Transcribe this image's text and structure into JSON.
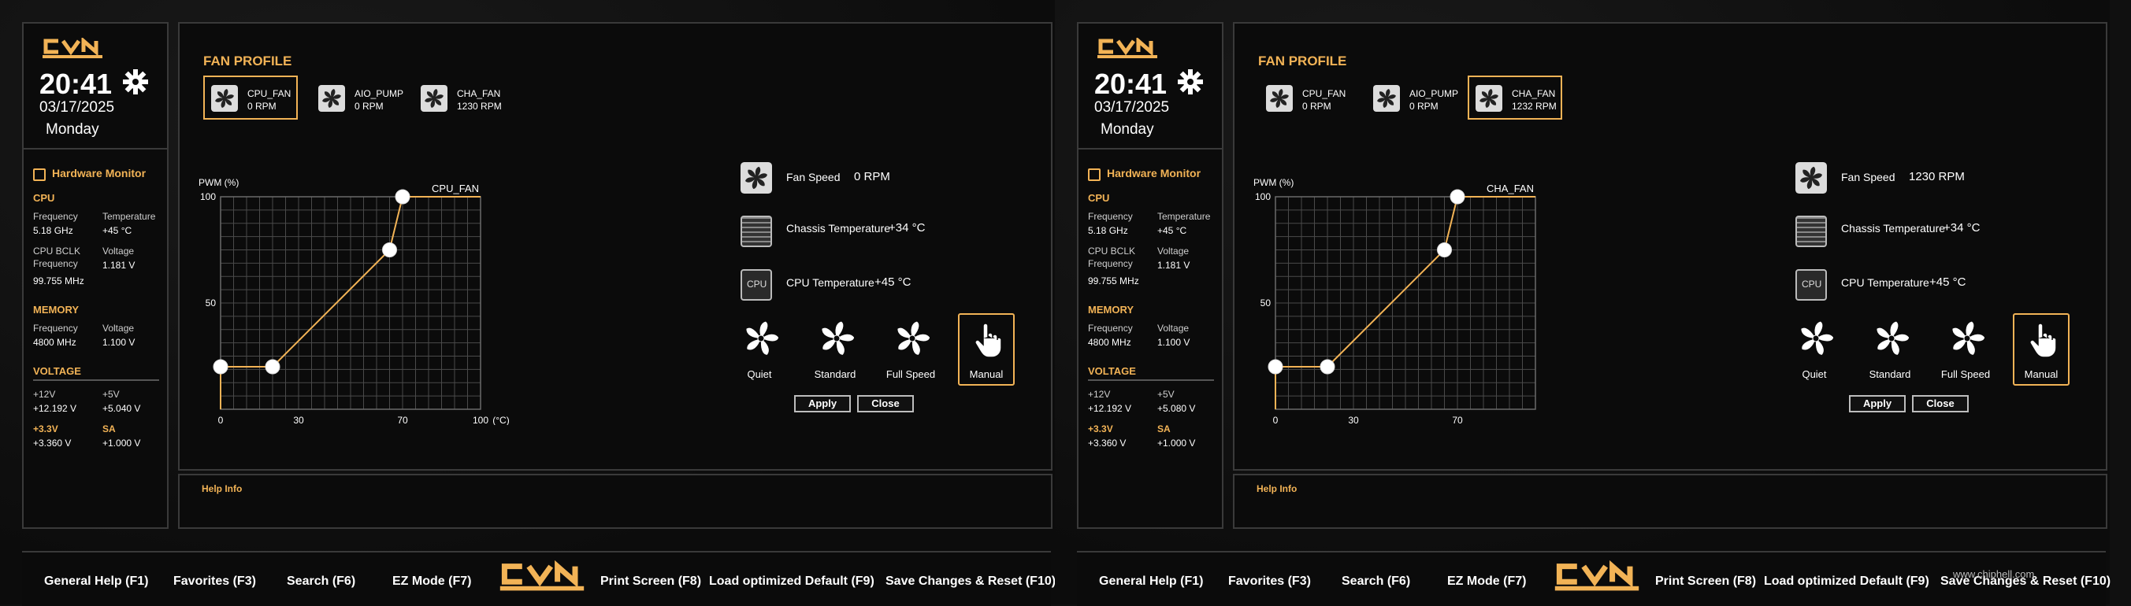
{
  "colors": {
    "accent": "#f2b356",
    "background": "#0b0b0b",
    "border": "#3a3a3a"
  },
  "screens": [
    {
      "logo": "CVN",
      "time": "20:41",
      "date": "03/17/2025",
      "day": "Monday",
      "section_title": "FAN PROFILE",
      "fans": [
        {
          "name": "CPU_FAN",
          "rpm": "0 RPM",
          "active": true
        },
        {
          "name": "AIO_PUMP",
          "rpm": "0 RPM",
          "active": false
        },
        {
          "name": "CHA_FAN",
          "rpm": "1230 RPM",
          "active": false
        }
      ],
      "chart_data": {
        "type": "line",
        "title": "CPU_FAN",
        "ylabel": "PWM",
        "ylabel_unit": "(%)",
        "xlabel_unit": "(°C)",
        "x": [
          0,
          0,
          20,
          65,
          70,
          100
        ],
        "y": [
          0,
          20,
          20,
          75,
          100,
          100
        ],
        "control_points_x": [
          0,
          20,
          65,
          70
        ],
        "control_points_y": [
          20,
          20,
          75,
          100
        ],
        "xlim": [
          0,
          100
        ],
        "ylim": [
          0,
          100
        ],
        "xticks": [
          "0",
          "30",
          "70",
          "100"
        ],
        "xtick_values": [
          0,
          30,
          70,
          100
        ],
        "yticks": [
          "100",
          "50"
        ],
        "ytick_values": [
          100,
          50
        ],
        "grid": true
      },
      "fan_speed_label": "Fan Speed",
      "fan_speed_value": "0 RPM",
      "chassis_temp_label": "Chassis Temperature",
      "chassis_temp_value": "+34 °C",
      "cpu_temp_label": "CPU Temperature",
      "cpu_temp_value": "+45 °C",
      "cpu_icon_text": "CPU",
      "modes": [
        "Quiet",
        "Standard",
        "Full Speed",
        "Manual"
      ],
      "active_mode": "Manual",
      "apply_label": "Apply",
      "close_label": "Close",
      "help_info": "Help Info",
      "hw": {
        "title": "Hardware Monitor",
        "cpu_title": "CPU",
        "freq_label": "Frequency",
        "freq_val": "5.18 GHz",
        "temp_label": "Temperature",
        "temp_val": "+45 °C",
        "bclk_label1": "CPU BCLK",
        "bclk_label2": "Frequency",
        "bclk_val": "99.755 MHz",
        "volt_label": "Voltage",
        "volt_val": "1.181 V",
        "mem_title": "MEMORY",
        "mem_freq_label": "Frequency",
        "mem_freq_val": "4800 MHz",
        "mem_volt_label": "Voltage",
        "mem_volt_val": "1.100 V",
        "voltage_title": "VOLTAGE",
        "v12_label": "+12V",
        "v12_val": "+12.192 V",
        "v5_label": "+5V",
        "v5_val": "+5.040 V",
        "v33_label": "+3.3V",
        "v33_val": "+3.360 V",
        "sa_label": "SA",
        "sa_val": "+1.000 V"
      },
      "bottom": [
        "General Help (F1)",
        "Favorites (F3)",
        "Search (F6)",
        "EZ Mode (F7)",
        "Print Screen (F8)",
        "Load optimized Default (F9)",
        "Save Changes & Reset (F10)"
      ]
    },
    {
      "logo": "CVN",
      "time": "20:41",
      "date": "03/17/2025",
      "day": "Monday",
      "section_title": "FAN PROFILE",
      "fans": [
        {
          "name": "CPU_FAN",
          "rpm": "0 RPM",
          "active": false
        },
        {
          "name": "AIO_PUMP",
          "rpm": "0 RPM",
          "active": false
        },
        {
          "name": "CHA_FAN",
          "rpm": "1232 RPM",
          "active": true
        }
      ],
      "chart_data": {
        "type": "line",
        "title": "CHA_FAN",
        "ylabel": "PWM",
        "ylabel_unit": "(%)",
        "xlabel_unit": "",
        "x": [
          0,
          0,
          20,
          65,
          70,
          100
        ],
        "y": [
          0,
          20,
          20,
          75,
          100,
          100
        ],
        "control_points_x": [
          0,
          20,
          65,
          70
        ],
        "control_points_y": [
          20,
          20,
          75,
          100
        ],
        "xlim": [
          0,
          100
        ],
        "ylim": [
          0,
          100
        ],
        "xticks": [
          "0",
          "30",
          "70"
        ],
        "xtick_values": [
          0,
          30,
          70
        ],
        "yticks": [
          "100",
          "50"
        ],
        "ytick_values": [
          100,
          50
        ],
        "grid": true
      },
      "fan_speed_label": "Fan Speed",
      "fan_speed_value": "1230 RPM",
      "chassis_temp_label": "Chassis Temperature",
      "chassis_temp_value": "+34 °C",
      "cpu_temp_label": "CPU Temperature",
      "cpu_temp_value": "+45 °C",
      "cpu_icon_text": "CPU",
      "modes": [
        "Quiet",
        "Standard",
        "Full Speed",
        "Manual"
      ],
      "active_mode": "Manual",
      "apply_label": "Apply",
      "close_label": "Close",
      "help_info": "Help Info",
      "hw": {
        "title": "Hardware Monitor",
        "cpu_title": "CPU",
        "freq_label": "Frequency",
        "freq_val": "5.18 GHz",
        "temp_label": "Temperature",
        "temp_val": "+45 °C",
        "bclk_label1": "CPU BCLK",
        "bclk_label2": "Frequency",
        "bclk_val": "99.755 MHz",
        "volt_label": "Voltage",
        "volt_val": "1.181 V",
        "mem_title": "MEMORY",
        "mem_freq_label": "Frequency",
        "mem_freq_val": "4800 MHz",
        "mem_volt_label": "Voltage",
        "mem_volt_val": "1.100 V",
        "voltage_title": "VOLTAGE",
        "v12_label": "+12V",
        "v12_val": "+12.192 V",
        "v5_label": "+5V",
        "v5_val": "+5.080 V",
        "v33_label": "+3.3V",
        "v33_val": "+3.360 V",
        "sa_label": "SA",
        "sa_val": "+1.000 V"
      },
      "bottom": [
        "General Help (F1)",
        "Favorites (F3)",
        "Search (F6)",
        "EZ Mode (F7)",
        "Print Screen (F8)",
        "Load optimized Default (F9)",
        "Save Changes & Reset (F10)"
      ],
      "watermark": "www.chiphell.com"
    }
  ]
}
